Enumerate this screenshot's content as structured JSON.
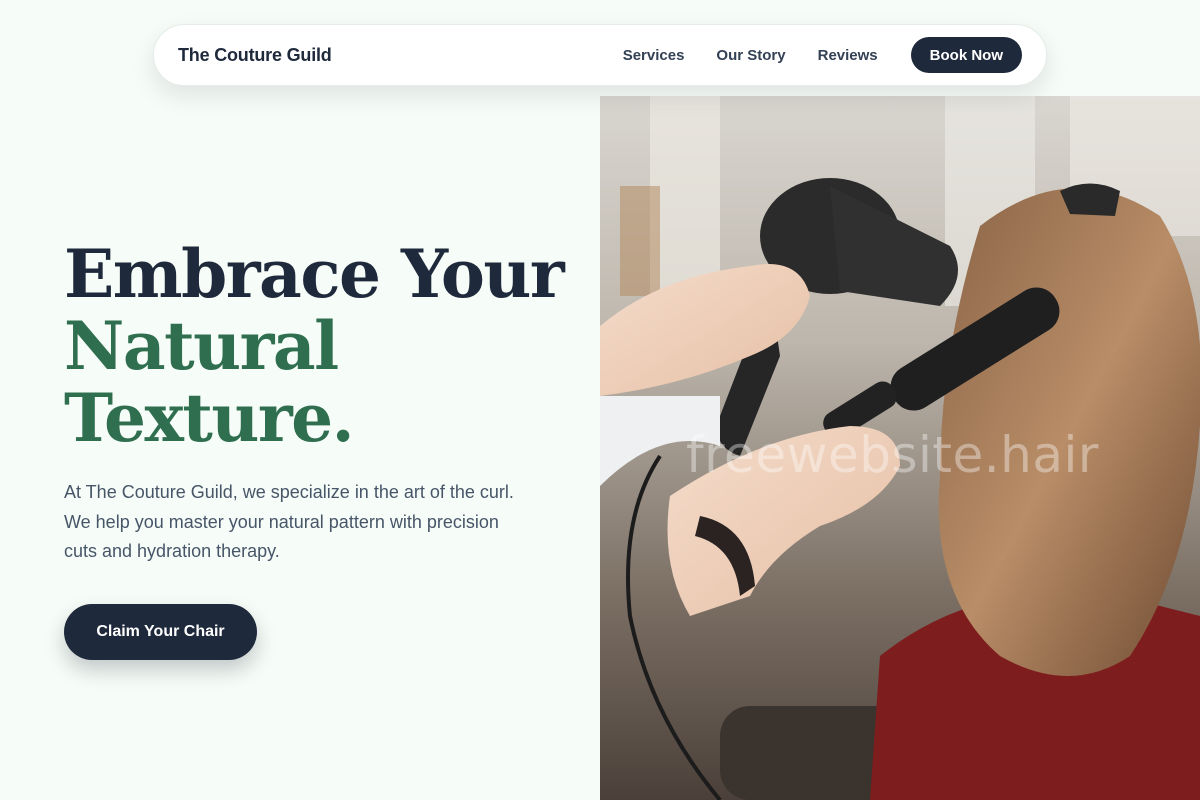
{
  "nav": {
    "brand": "The Couture Guild",
    "links": [
      {
        "label": "Services"
      },
      {
        "label": "Our Story"
      },
      {
        "label": "Reviews"
      }
    ],
    "cta_label": "Book Now"
  },
  "hero": {
    "headline_line1": "Embrace Your",
    "headline_line2": "Natural",
    "headline_line3": "Texture.",
    "lead": "At The Couture Guild, we specialize in the art of the curl. We help you master your natural pattern with precision cuts and hydration therapy.",
    "cta_label": "Claim Your Chair",
    "image_watermark": "freewebsite.hair"
  },
  "colors": {
    "background": "#f6fcf7",
    "navy": "#1e293b",
    "green_accent": "#2f6f4f",
    "body_text": "#475569"
  }
}
